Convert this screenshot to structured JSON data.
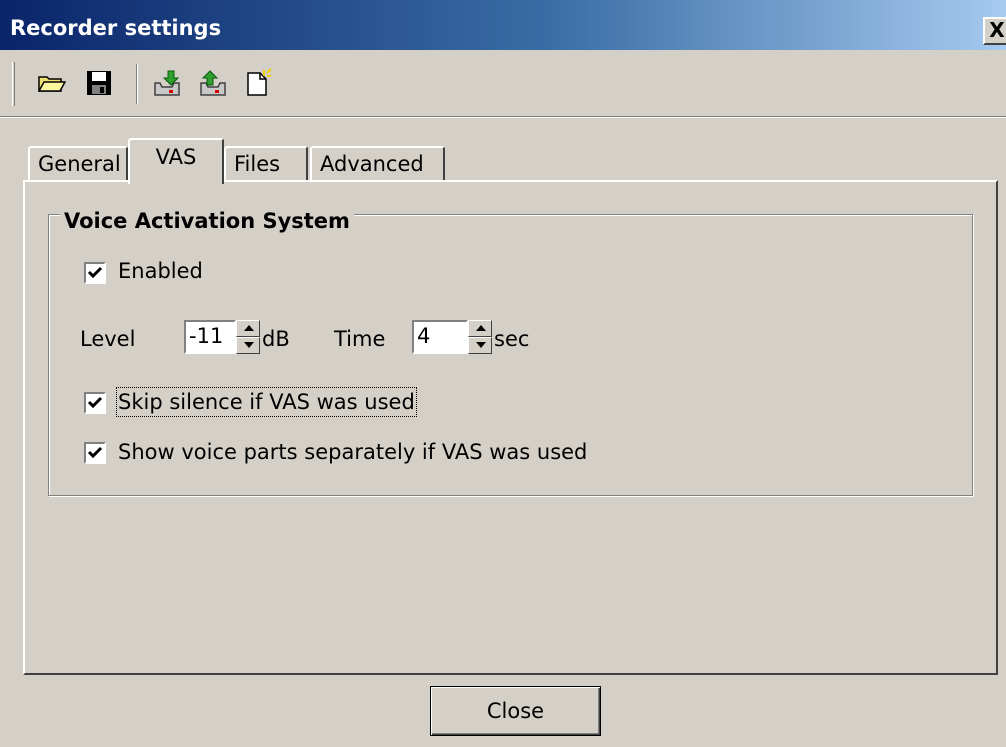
{
  "window": {
    "title": "Recorder settings",
    "close_glyph": "X"
  },
  "toolbar": {
    "buttons": [
      {
        "icon": "open-folder-icon"
      },
      {
        "icon": "save-disk-icon"
      },
      {
        "icon": "import-icon"
      },
      {
        "icon": "export-icon"
      },
      {
        "icon": "new-document-icon"
      }
    ]
  },
  "tabs": [
    {
      "label": "General",
      "active": false
    },
    {
      "label": "VAS",
      "active": true
    },
    {
      "label": "Files",
      "active": false
    },
    {
      "label": "Advanced",
      "active": false
    }
  ],
  "vas": {
    "group_title": "Voice Activation System",
    "enabled": {
      "label": "Enabled",
      "checked": true
    },
    "level": {
      "label": "Level",
      "value": "-11",
      "unit": "dB"
    },
    "time": {
      "label": "Time",
      "value": "4",
      "unit": "sec"
    },
    "skip_silence": {
      "label": "Skip silence if VAS was used",
      "checked": true
    },
    "show_voice_parts": {
      "label": "Show voice parts separately if VAS was used",
      "checked": true
    }
  },
  "footer": {
    "close_label": "Close"
  },
  "colors": {
    "dialog_bg": "#d4d0c8",
    "titlebar_start": "#0a246a",
    "titlebar_end": "#a6caf0"
  }
}
